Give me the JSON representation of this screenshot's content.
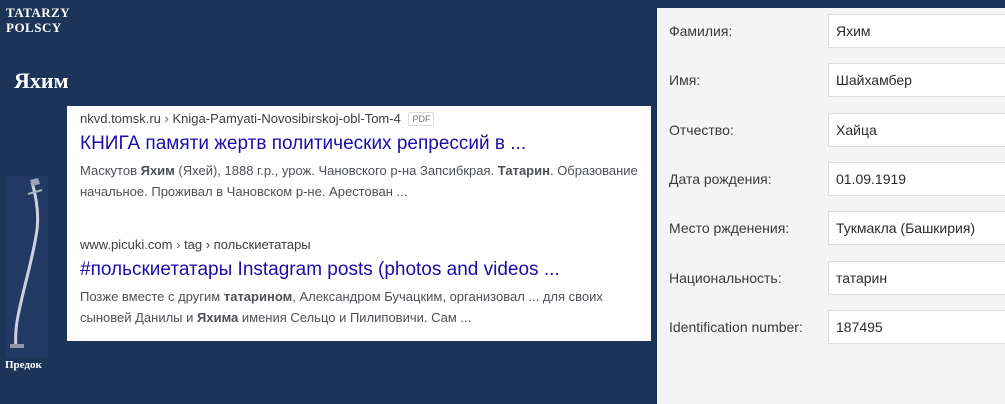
{
  "brand": {
    "line1": "TATARZY",
    "line2": "POLSCY"
  },
  "page_title": "Яхим",
  "ancestor_caption": "Предок",
  "search_results": [
    {
      "domain": "nkvd.tomsk.ru",
      "separator": "›",
      "path": "Kniga-Pamyati-Novosibirskoj-obl-Tom-4",
      "badge": "PDF",
      "title": "КНИГА памяти жертв политических репрессий в ...",
      "snippet": [
        {
          "text": "Маскутов ",
          "bold": false
        },
        {
          "text": "Яхим",
          "bold": true
        },
        {
          "text": " (Яхей), 1888 г.р., урож. Чановского р-на Запсибкрая. ",
          "bold": false
        },
        {
          "text": "Татарин",
          "bold": true
        },
        {
          "text": ". Образование начальное. Проживал в Чановском р-не. Арестован ...",
          "bold": false
        }
      ]
    },
    {
      "domain": "www.picuki.com",
      "separator": "›",
      "path": "tag › польскиетатары",
      "badge": "",
      "title": "#польскиетатары Instagram posts (photos and videos ...",
      "snippet": [
        {
          "text": "Позже вместе с другим ",
          "bold": false
        },
        {
          "text": "татарином",
          "bold": true
        },
        {
          "text": ", Александром Бучацким, организовал ... для своих сыновей Данилы и ",
          "bold": false
        },
        {
          "text": "Яхима",
          "bold": true
        },
        {
          "text": " имения Сельцо и Пилиповичи. Сам ...",
          "bold": false
        }
      ]
    }
  ],
  "fields": [
    {
      "label": "Фамилия:",
      "value": "Яхим"
    },
    {
      "label": "Имя:",
      "value": "Шайхамбер"
    },
    {
      "label": "Отчество:",
      "value": "Хайца"
    },
    {
      "label": "Дата рождения:",
      "value": "01.09.1919"
    },
    {
      "label": "Место ржденения:",
      "value": "Тукмакла (Башкирия)"
    },
    {
      "label": "Национальность:",
      "value": "татарин"
    },
    {
      "label": "Identification number:",
      "value": "187495"
    }
  ],
  "colors": {
    "background": "#1d3459",
    "link": "#1a0dab",
    "card": "#f4f4f4"
  }
}
